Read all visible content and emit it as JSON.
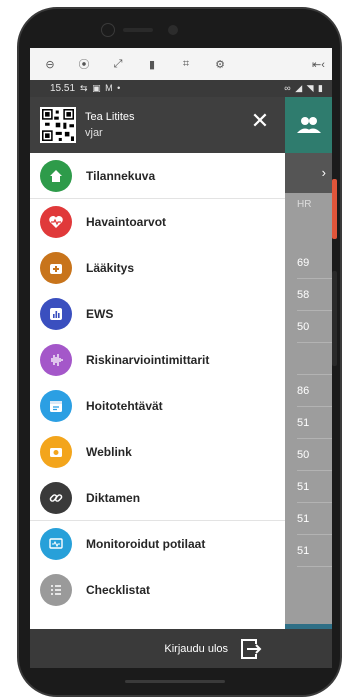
{
  "toolbar": {
    "icons": [
      "minus-circle-icon",
      "broadcast-icon",
      "expand-icon",
      "phone-icon",
      "scan-icon",
      "settings-icon",
      "collapse-icon"
    ],
    "glyphs": [
      "⊖",
      "⦿",
      "⤢",
      "▮",
      "⌗",
      "⚙",
      "⇤‹"
    ]
  },
  "status_bar": {
    "time": "15.51",
    "left_icons": "⇆ ▣ M •",
    "right_icons": "∞ ◢ ◥ ▮"
  },
  "drawer": {
    "user_name": "Tea Litites",
    "user_id": "vjar",
    "close_glyph": "✕",
    "items": [
      {
        "label": "Tilannekuva",
        "color": "#2e9b4a",
        "icon": "home-icon"
      },
      {
        "label": "Havaintoarvot",
        "color": "#e0393a",
        "icon": "heart-pulse-icon"
      },
      {
        "label": "Lääkitys",
        "color": "#c8741b",
        "icon": "medical-kit-icon"
      },
      {
        "label": "EWS",
        "color": "#3a4fbf",
        "icon": "bar-chart-icon"
      },
      {
        "label": "Riskinarviointimittarit",
        "color": "#a457c9",
        "icon": "waveform-icon"
      },
      {
        "label": "Hoitotehtävät",
        "color": "#2b9fe3",
        "icon": "calendar-icon"
      },
      {
        "label": "Weblink",
        "color": "#f3a51c",
        "icon": "camera-icon"
      },
      {
        "label": "Diktamen",
        "color": "#3a3a3a",
        "icon": "link-icon"
      },
      {
        "label": "Monitoroidut potilaat",
        "color": "#27a0d9",
        "icon": "monitor-icon"
      },
      {
        "label": "Checklistat",
        "color": "#9a9a9a",
        "icon": "checklist-icon"
      }
    ]
  },
  "footer": {
    "logout_label": "Kirjaudu ulos"
  },
  "background_list": {
    "column_header": "HR",
    "values": [
      "69",
      "58",
      "50",
      "",
      "86",
      "51",
      "50",
      "51",
      "51",
      "51"
    ]
  }
}
